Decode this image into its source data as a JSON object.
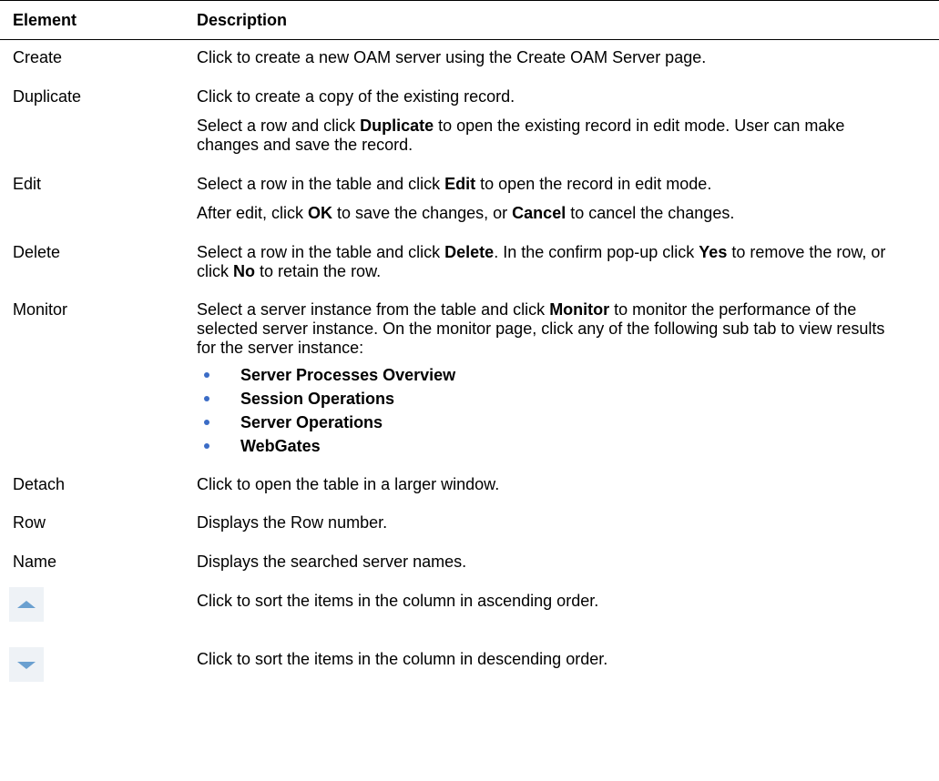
{
  "header": {
    "element": "Element",
    "description": "Description"
  },
  "rows": [
    {
      "element": "Create",
      "paras": [
        [
          "Click to create a new OAM server using the Create OAM Server page."
        ]
      ]
    },
    {
      "element": "Duplicate",
      "paras": [
        [
          "Click to create a copy of the existing record."
        ],
        [
          "Select a row and click ",
          "Duplicate",
          " to open the existing record in edit mode. User can make changes and save the record."
        ]
      ]
    },
    {
      "element": "Edit",
      "paras": [
        [
          "Select a row in the table and click ",
          "Edit",
          " to open the record in edit mode."
        ],
        [
          "After edit, click ",
          "OK",
          " to save the changes, or ",
          "Cancel",
          " to cancel the changes."
        ]
      ]
    },
    {
      "element": "Delete",
      "paras": [
        [
          "Select a row in the table and click ",
          "Delete",
          ". In the confirm pop-up click ",
          "Yes",
          " to remove the row, or click ",
          "No",
          " to retain the row."
        ]
      ]
    },
    {
      "element": "Monitor",
      "paras": [
        [
          "Select a server instance from the table and click ",
          "Monitor",
          " to monitor the performance of the selected server instance. On the monitor page, click any of the following sub tab to view results for the server instance:"
        ]
      ],
      "bullets": [
        "Server Processes Overview",
        "Session Operations",
        "Server Operations",
        "WebGates"
      ]
    },
    {
      "element": "Detach",
      "paras": [
        [
          "Click to open the table in a larger window."
        ]
      ]
    },
    {
      "element": "Row",
      "paras": [
        [
          "Displays the Row number."
        ]
      ]
    },
    {
      "element": "Name",
      "paras": [
        [
          "Displays the searched server names."
        ]
      ]
    },
    {
      "icon": "sort-ascending-icon",
      "paras": [
        [
          "Click to sort the items in the column in ascending order."
        ]
      ]
    },
    {
      "icon": "sort-descending-icon",
      "paras": [
        [
          "Click to sort the items in the column in descending order."
        ]
      ]
    }
  ],
  "colors": {
    "bullet": "#3b6cc6",
    "sort_arrow": "#6aa0d0",
    "icon_bg": "#eef2f6"
  }
}
